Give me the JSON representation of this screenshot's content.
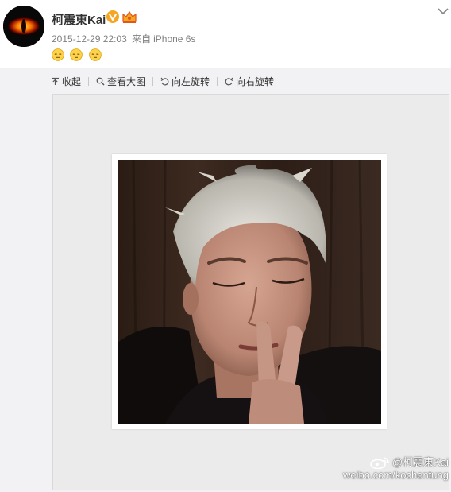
{
  "post": {
    "author": "柯震東Kai",
    "timestamp": "2015-12-29 22:03",
    "source_prefix": "来自",
    "source": "iPhone 6s",
    "emoji_icons": [
      "sleepy-face-icon",
      "sleepy-face-icon",
      "sleepy-face-icon"
    ]
  },
  "toolbar": {
    "collapse": "收起",
    "view_large": "查看大图",
    "rotate_left": "向左旋转",
    "rotate_right": "向右旋转"
  },
  "watermark": {
    "handle": "@柯震東Kai",
    "url": "weibo.com/kochentung"
  },
  "colors": {
    "accent_orange": "#f5a623",
    "media_background": "#f2f2f5",
    "meta_gray": "#808080"
  }
}
